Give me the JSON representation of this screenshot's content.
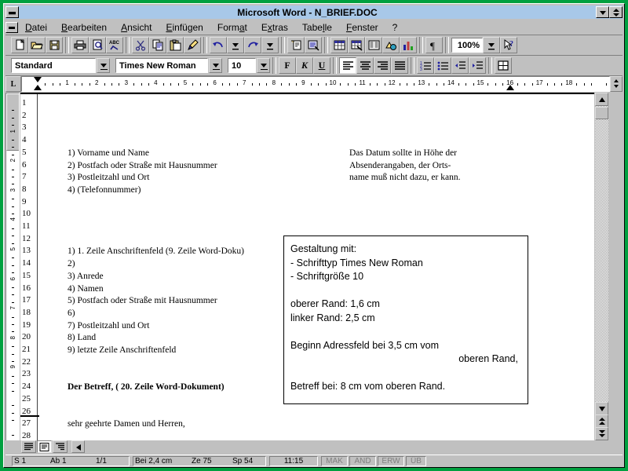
{
  "window": {
    "title": "Microsoft Word - N_BRIEF.DOC",
    "minimize_label": "minimize",
    "maximize_label": "maximize"
  },
  "menu": {
    "items": [
      {
        "label": "Datei",
        "mnemonic": "D"
      },
      {
        "label": "Bearbeiten",
        "mnemonic": "B"
      },
      {
        "label": "Ansicht",
        "mnemonic": "A"
      },
      {
        "label": "Einfügen",
        "mnemonic": "E"
      },
      {
        "label": "Format",
        "mnemonic": "a"
      },
      {
        "label": "Extras",
        "mnemonic": "x"
      },
      {
        "label": "Tabelle",
        "mnemonic": "l"
      },
      {
        "label": "Fenster",
        "mnemonic": "F"
      },
      {
        "label": "?",
        "mnemonic": ""
      }
    ]
  },
  "standard_toolbar": {
    "buttons": [
      {
        "name": "new-document-icon",
        "tip": "Neu"
      },
      {
        "name": "open-folder-icon",
        "tip": "Öffnen"
      },
      {
        "name": "save-disk-icon",
        "tip": "Speichern"
      },
      {
        "name": "print-icon",
        "tip": "Drucken"
      },
      {
        "name": "print-preview-icon",
        "tip": "Seitenansicht"
      },
      {
        "name": "spellcheck-abc-icon",
        "tip": "Rechtschreibung"
      },
      {
        "name": "cut-scissors-icon",
        "tip": "Ausschneiden"
      },
      {
        "name": "copy-icon",
        "tip": "Kopieren"
      },
      {
        "name": "paste-clipboard-icon",
        "tip": "Einfügen"
      },
      {
        "name": "format-painter-brush-icon",
        "tip": "Format übertragen"
      },
      {
        "name": "undo-arrow-icon",
        "tip": "Rückgängig"
      },
      {
        "name": "undo-dropdown-icon",
        "tip": "Rückgängig Liste"
      },
      {
        "name": "redo-arrow-icon",
        "tip": "Wiederherstellen"
      },
      {
        "name": "redo-dropdown-icon",
        "tip": "Wiederherstellen Liste"
      },
      {
        "name": "autotext-icon",
        "tip": "AutoText"
      },
      {
        "name": "autoformat-icon",
        "tip": "AutoFormat"
      },
      {
        "name": "insert-table-icon",
        "tip": "Tabelle einfügen"
      },
      {
        "name": "insert-excel-table-icon",
        "tip": "Excel-Tabelle einfügen"
      },
      {
        "name": "columns-icon",
        "tip": "Spalten"
      },
      {
        "name": "drawing-icon",
        "tip": "Zeichnen"
      },
      {
        "name": "chart-icon",
        "tip": "Diagramm"
      },
      {
        "name": "show-paragraph-marks-icon",
        "tip": "Einblenden/Ausblenden"
      }
    ],
    "zoom_value": "100%",
    "zoom_dropdown": "zoom-dropdown-icon",
    "help_button": "help-arrow-icon"
  },
  "format_toolbar": {
    "style_value": "Standard",
    "font_value": "Times New Roman",
    "size_value": "10",
    "bold_label": "F",
    "italic_label": "K",
    "underline_label": "U",
    "align_buttons": [
      "align-left-icon",
      "align-center-icon",
      "align-right-icon",
      "align-justify-icon"
    ],
    "list_buttons": [
      "numbered-list-icon",
      "bulleted-list-icon",
      "decrease-indent-icon",
      "increase-indent-icon"
    ],
    "borders_button": "borders-icon"
  },
  "ruler": {
    "tab_selector_glyph": "L",
    "unit": "cm",
    "numbers": [
      1,
      2,
      3,
      4,
      5,
      6,
      7,
      8,
      9,
      10,
      11,
      12,
      13,
      14,
      15,
      16,
      17,
      18
    ],
    "left_indent_cm": 0,
    "right_indent_cm": 16
  },
  "vertical_ruler": {
    "numbers": [
      1,
      2,
      3,
      4,
      5,
      6,
      7,
      8,
      9
    ]
  },
  "document": {
    "line_numbers": [
      1,
      2,
      3,
      4,
      5,
      6,
      7,
      8,
      9,
      10,
      11,
      12,
      13,
      14,
      15,
      16,
      17,
      18,
      19,
      20,
      21,
      22,
      23,
      24,
      25,
      26,
      27,
      28
    ],
    "left_lines": [
      {
        "line": 5,
        "text": "1) Vorname und Name",
        "bold": false
      },
      {
        "line": 6,
        "text": "2) Postfach oder Straße mit Hausnummer",
        "bold": false
      },
      {
        "line": 7,
        "text": "3) Postleitzahl und Ort",
        "bold": false
      },
      {
        "line": 8,
        "text": "4) (Telefonnummer)",
        "bold": false
      },
      {
        "line": 13,
        "text": "1) 1. Zeile Anschriftenfeld (9. Zeile Word-Doku)",
        "bold": false
      },
      {
        "line": 14,
        "text": "2)",
        "bold": false
      },
      {
        "line": 15,
        "text": "3) Anrede",
        "bold": false
      },
      {
        "line": 16,
        "text": "4) Namen",
        "bold": false
      },
      {
        "line": 17,
        "text": "5) Postfach oder Straße mit Hausnummer",
        "bold": false
      },
      {
        "line": 18,
        "text": "6)",
        "bold": false
      },
      {
        "line": 19,
        "text": "7) Postleitzahl und Ort",
        "bold": false
      },
      {
        "line": 20,
        "text": "8) Land",
        "bold": false
      },
      {
        "line": 21,
        "text": "9) letzte Zeile Anschriftenfeld",
        "bold": false
      },
      {
        "line": 24,
        "text": "Der Betreff, ( 20. Zeile Word-Dokument)",
        "bold": true
      },
      {
        "line": 27,
        "text": "sehr geehrte Damen und Herren,",
        "bold": false
      }
    ],
    "right_note": [
      {
        "line": 5,
        "text": "Das Datum sollte in Höhe der"
      },
      {
        "line": 6,
        "text": "Absenderangaben, der Orts-"
      },
      {
        "line": 7,
        "text": "name muß nicht dazu, er kann."
      }
    ],
    "info_box": [
      {
        "text": "Gestaltung mit:",
        "align": "left"
      },
      {
        "text": "- Schrifttyp Times New Roman",
        "align": "left"
      },
      {
        "text": "- Schriftgröße 10",
        "align": "left"
      },
      {
        "text": "",
        "align": "left"
      },
      {
        "text": "oberer Rand: 1,6 cm",
        "align": "left"
      },
      {
        "text": "linker Rand: 2,5 cm",
        "align": "left"
      },
      {
        "text": "",
        "align": "left"
      },
      {
        "text": "Beginn Adressfeld bei 3,5 cm vom",
        "align": "left"
      },
      {
        "text": "oberen Rand,",
        "align": "right"
      },
      {
        "text": "",
        "align": "left"
      },
      {
        "text": "Betreff bei: 8 cm vom oberen Rand.",
        "align": "left"
      }
    ]
  },
  "view_buttons": [
    {
      "name": "normal-view-button",
      "tip": "Normalansicht"
    },
    {
      "name": "page-layout-view-button",
      "tip": "Seitenlayout"
    },
    {
      "name": "outline-view-button",
      "tip": "Gliederung"
    }
  ],
  "status_bar": {
    "page": "S 1",
    "section": "Ab 1",
    "page_of": "1/1",
    "position": "Bei 2,4 cm",
    "line": "Ze 75",
    "column": "Sp 54",
    "time": "11:15",
    "indicators": [
      "MAK",
      "AND",
      "ERW",
      "ÜB"
    ]
  },
  "colors": {
    "desktop": "#00a040",
    "titlebar": "#a8c8e8",
    "face": "#c0c0c0",
    "page": "#ffffff"
  }
}
